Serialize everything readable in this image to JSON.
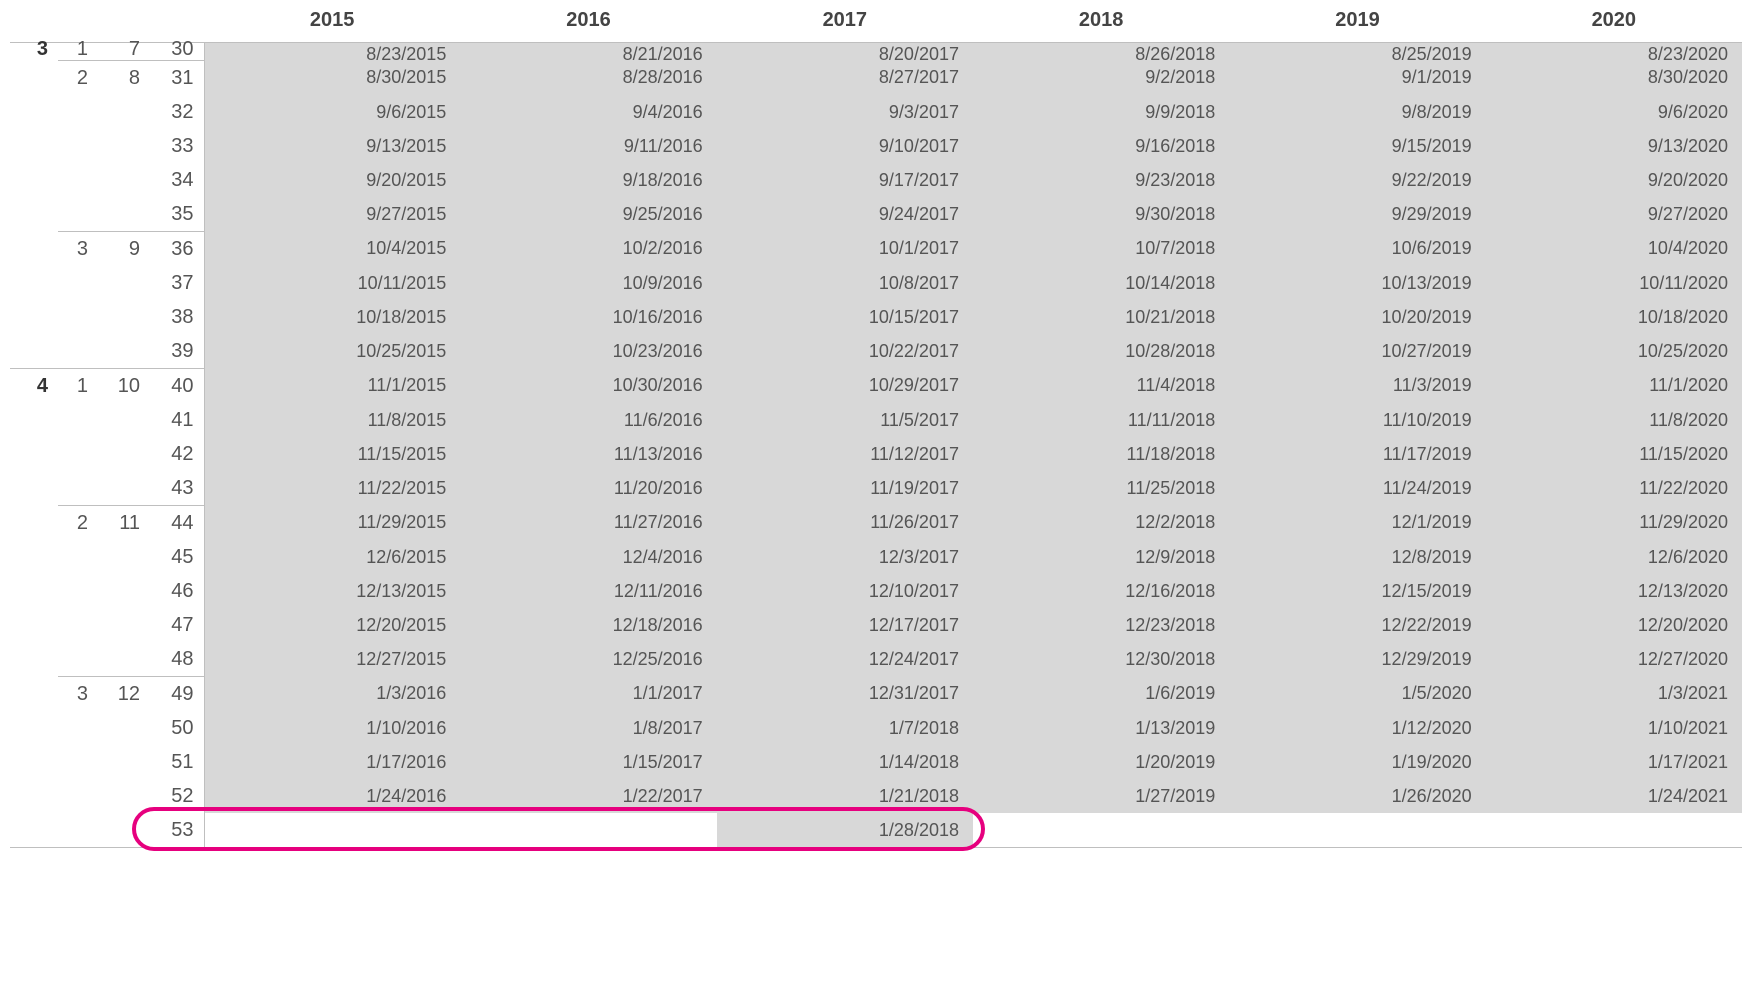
{
  "years": [
    "2015",
    "2016",
    "2017",
    "2018",
    "2019",
    "2020"
  ],
  "rows": [
    {
      "g1": "3",
      "g2": "1",
      "g3": "7",
      "g4": "30",
      "clipped": true,
      "btop2": true,
      "cells": [
        "8/23/2015",
        "8/21/2016",
        "8/20/2017",
        "8/26/2018",
        "8/25/2019",
        "8/23/2020"
      ]
    },
    {
      "g1": "",
      "g2": "2",
      "g3": "8",
      "g4": "31",
      "btop2": true,
      "cells": [
        "8/30/2015",
        "8/28/2016",
        "8/27/2017",
        "9/2/2018",
        "9/1/2019",
        "8/30/2020"
      ]
    },
    {
      "g1": "",
      "g2": "",
      "g3": "",
      "g4": "32",
      "cells": [
        "9/6/2015",
        "9/4/2016",
        "9/3/2017",
        "9/9/2018",
        "9/8/2019",
        "9/6/2020"
      ]
    },
    {
      "g1": "",
      "g2": "",
      "g3": "",
      "g4": "33",
      "cells": [
        "9/13/2015",
        "9/11/2016",
        "9/10/2017",
        "9/16/2018",
        "9/15/2019",
        "9/13/2020"
      ]
    },
    {
      "g1": "",
      "g2": "",
      "g3": "",
      "g4": "34",
      "cells": [
        "9/20/2015",
        "9/18/2016",
        "9/17/2017",
        "9/23/2018",
        "9/22/2019",
        "9/20/2020"
      ]
    },
    {
      "g1": "",
      "g2": "",
      "g3": "",
      "g4": "35",
      "cells": [
        "9/27/2015",
        "9/25/2016",
        "9/24/2017",
        "9/30/2018",
        "9/29/2019",
        "9/27/2020"
      ]
    },
    {
      "g1": "",
      "g2": "3",
      "g3": "9",
      "g4": "36",
      "btop2": true,
      "cells": [
        "10/4/2015",
        "10/2/2016",
        "10/1/2017",
        "10/7/2018",
        "10/6/2019",
        "10/4/2020"
      ]
    },
    {
      "g1": "",
      "g2": "",
      "g3": "",
      "g4": "37",
      "cells": [
        "10/11/2015",
        "10/9/2016",
        "10/8/2017",
        "10/14/2018",
        "10/13/2019",
        "10/11/2020"
      ]
    },
    {
      "g1": "",
      "g2": "",
      "g3": "",
      "g4": "38",
      "cells": [
        "10/18/2015",
        "10/16/2016",
        "10/15/2017",
        "10/21/2018",
        "10/20/2019",
        "10/18/2020"
      ]
    },
    {
      "g1": "",
      "g2": "",
      "g3": "",
      "g4": "39",
      "cells": [
        "10/25/2015",
        "10/23/2016",
        "10/22/2017",
        "10/28/2018",
        "10/27/2019",
        "10/25/2020"
      ]
    },
    {
      "g1": "4",
      "g2": "1",
      "g3": "10",
      "g4": "40",
      "btop1": true,
      "cells": [
        "11/1/2015",
        "10/30/2016",
        "10/29/2017",
        "11/4/2018",
        "11/3/2019",
        "11/1/2020"
      ]
    },
    {
      "g1": "",
      "g2": "",
      "g3": "",
      "g4": "41",
      "cells": [
        "11/8/2015",
        "11/6/2016",
        "11/5/2017",
        "11/11/2018",
        "11/10/2019",
        "11/8/2020"
      ]
    },
    {
      "g1": "",
      "g2": "",
      "g3": "",
      "g4": "42",
      "cells": [
        "11/15/2015",
        "11/13/2016",
        "11/12/2017",
        "11/18/2018",
        "11/17/2019",
        "11/15/2020"
      ]
    },
    {
      "g1": "",
      "g2": "",
      "g3": "",
      "g4": "43",
      "cells": [
        "11/22/2015",
        "11/20/2016",
        "11/19/2017",
        "11/25/2018",
        "11/24/2019",
        "11/22/2020"
      ]
    },
    {
      "g1": "",
      "g2": "2",
      "g3": "11",
      "g4": "44",
      "btop2": true,
      "cells": [
        "11/29/2015",
        "11/27/2016",
        "11/26/2017",
        "12/2/2018",
        "12/1/2019",
        "11/29/2020"
      ]
    },
    {
      "g1": "",
      "g2": "",
      "g3": "",
      "g4": "45",
      "cells": [
        "12/6/2015",
        "12/4/2016",
        "12/3/2017",
        "12/9/2018",
        "12/8/2019",
        "12/6/2020"
      ]
    },
    {
      "g1": "",
      "g2": "",
      "g3": "",
      "g4": "46",
      "cells": [
        "12/13/2015",
        "12/11/2016",
        "12/10/2017",
        "12/16/2018",
        "12/15/2019",
        "12/13/2020"
      ]
    },
    {
      "g1": "",
      "g2": "",
      "g3": "",
      "g4": "47",
      "cells": [
        "12/20/2015",
        "12/18/2016",
        "12/17/2017",
        "12/23/2018",
        "12/22/2019",
        "12/20/2020"
      ]
    },
    {
      "g1": "",
      "g2": "",
      "g3": "",
      "g4": "48",
      "cells": [
        "12/27/2015",
        "12/25/2016",
        "12/24/2017",
        "12/30/2018",
        "12/29/2019",
        "12/27/2020"
      ]
    },
    {
      "g1": "",
      "g2": "3",
      "g3": "12",
      "g4": "49",
      "btop2": true,
      "cells": [
        "1/3/2016",
        "1/1/2017",
        "12/31/2017",
        "1/6/2019",
        "1/5/2020",
        "1/3/2021"
      ]
    },
    {
      "g1": "",
      "g2": "",
      "g3": "",
      "g4": "50",
      "cells": [
        "1/10/2016",
        "1/8/2017",
        "1/7/2018",
        "1/13/2019",
        "1/12/2020",
        "1/10/2021"
      ]
    },
    {
      "g1": "",
      "g2": "",
      "g3": "",
      "g4": "51",
      "cells": [
        "1/17/2016",
        "1/15/2017",
        "1/14/2018",
        "1/20/2019",
        "1/19/2020",
        "1/17/2021"
      ]
    },
    {
      "g1": "",
      "g2": "",
      "g3": "",
      "g4": "52",
      "cells": [
        "1/24/2016",
        "1/22/2017",
        "1/21/2018",
        "1/27/2019",
        "1/26/2020",
        "1/24/2021"
      ]
    },
    {
      "g1": "",
      "g2": "",
      "g3": "",
      "g4": "53",
      "last": true,
      "cells": [
        "",
        "",
        "1/28/2018",
        "",
        "",
        ""
      ]
    }
  ],
  "highlight": {
    "row_index": 23
  }
}
